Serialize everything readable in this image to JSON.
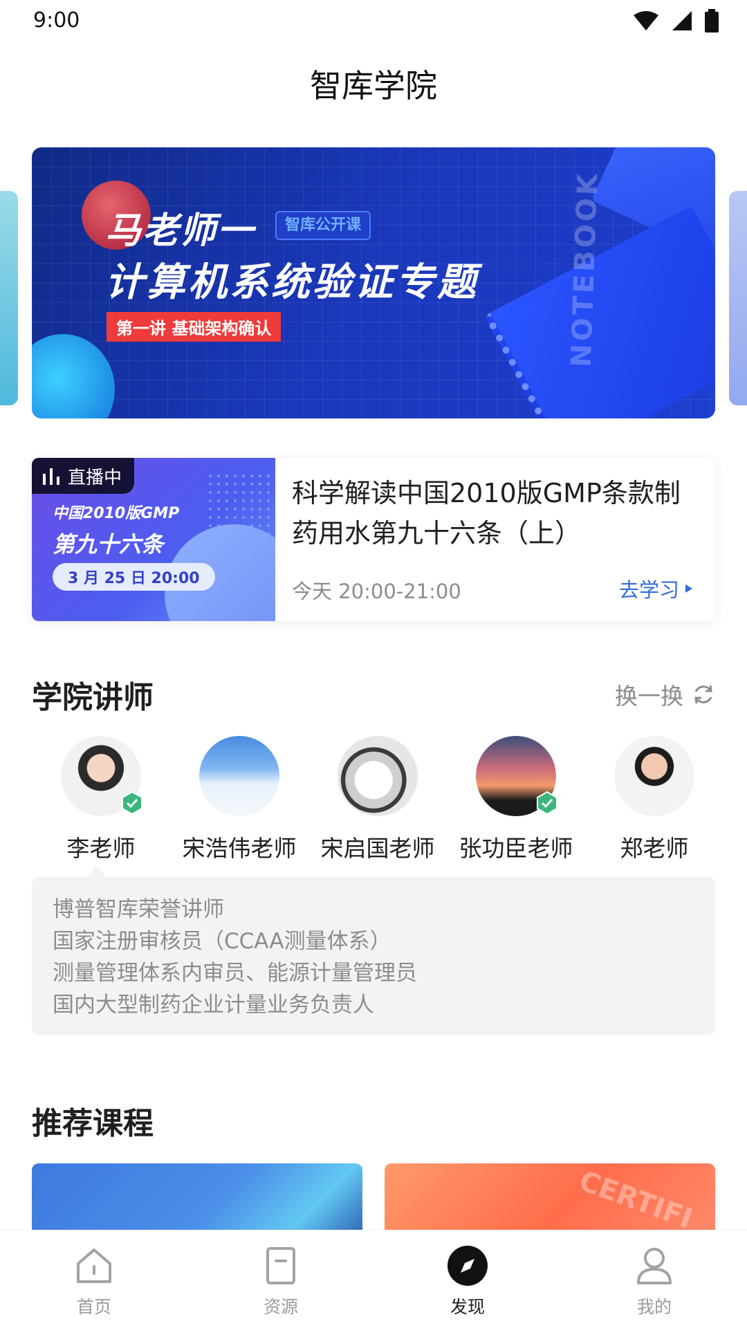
{
  "status_bar": {
    "time": "9:00"
  },
  "header": {
    "title": "智库学院"
  },
  "banner": {
    "title_line1": "马老师一",
    "badge": "智库公开课",
    "title_line2": "计算机系统验证专题",
    "subtitle": "第一讲 基础架构确认",
    "notebook_text": "NOTEBOOK"
  },
  "live_course": {
    "badge_label": "直播中",
    "thumb_line1": "中国2010版GMP",
    "thumb_line2": "第九十六条",
    "thumb_date": "3 月 25 日 20:00",
    "title": "科学解读中国2010版GMP条款制药用水第九十六条（上）",
    "time": "今天 20:00-21:00",
    "action_label": "去学习"
  },
  "teachers_section": {
    "title": "学院讲师",
    "swap_label": "换一换",
    "teachers": [
      {
        "name": "李老师",
        "verified": true
      },
      {
        "name": "宋浩伟老师",
        "verified": false
      },
      {
        "name": "宋启国老师",
        "verified": false
      },
      {
        "name": "张功臣老师",
        "verified": true
      },
      {
        "name": "郑老师",
        "verified": false
      }
    ],
    "selected_bio": [
      "博普智库荣誉讲师",
      "国家注册审核员（CCAA测量体系）",
      "测量管理体系内审员、能源计量管理员",
      "国内大型制药企业计量业务负责人"
    ]
  },
  "recommend_section": {
    "title": "推荐课程",
    "course_b_text": "CERTIFI"
  },
  "tabbar": {
    "tabs": [
      {
        "label": "首页",
        "icon": "home-icon",
        "active": false
      },
      {
        "label": "资源",
        "icon": "document-icon",
        "active": false
      },
      {
        "label": "发现",
        "icon": "compass-icon",
        "active": true
      },
      {
        "label": "我的",
        "icon": "user-icon",
        "active": false
      }
    ]
  },
  "colors": {
    "accent_blue": "#2f6bdc",
    "verified_green": "#3bb77e",
    "live_badge_bg": "#000000"
  }
}
